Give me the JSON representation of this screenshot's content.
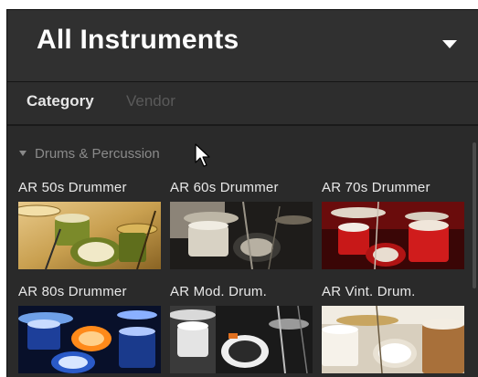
{
  "header": {
    "title": "All Instruments"
  },
  "tabs": [
    {
      "label": "Category",
      "active": true
    },
    {
      "label": "Vendor",
      "active": false
    }
  ],
  "section": {
    "label": "Drums & Percussion"
  },
  "items": [
    {
      "label": "AR 50s Drummer"
    },
    {
      "label": "AR 60s Drummer"
    },
    {
      "label": "AR 70s Drummer"
    },
    {
      "label": "AR 80s Drummer"
    },
    {
      "label": "AR Mod. Drum."
    },
    {
      "label": "AR Vint. Drum."
    }
  ],
  "colors": {
    "panel": "#2a2a2a",
    "header": "#303030",
    "text": "#ffffff",
    "inactive_tab": "#5a5a5a"
  },
  "icons": {
    "header_dropdown": "chevron-down-icon",
    "section_toggle": "triangle-down-icon"
  }
}
